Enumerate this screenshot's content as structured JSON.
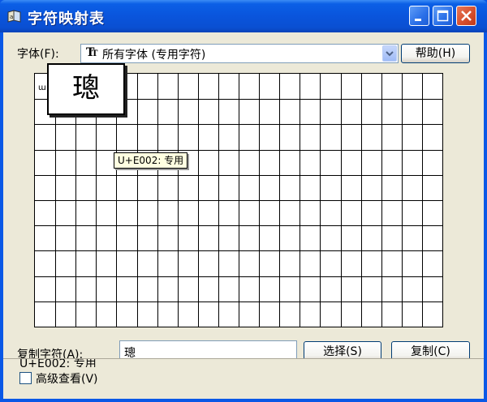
{
  "window": {
    "title": "字符映射表"
  },
  "font_row": {
    "label": "字体(F):",
    "selected_font": "所有字体 (专用字符)",
    "help_button": "帮助(H)"
  },
  "grid": {
    "first_cell_char": "ա",
    "zoom_char": "璁",
    "tooltip": "U+E002: 专用",
    "rows": 10,
    "cols": 20
  },
  "copy_row": {
    "label": "复制字符(A):",
    "value": "璁",
    "select_button": "选择(S)",
    "copy_button": "复制(C)"
  },
  "advanced": {
    "label": "高级查看(V)",
    "checked": false
  },
  "status": {
    "text": "U+E002: 专用"
  },
  "colors": {
    "title_bar": "#0a55dc",
    "client_bg": "#ece9d8",
    "close_button": "#d54d2b",
    "tooltip_bg": "#ffffe1"
  }
}
